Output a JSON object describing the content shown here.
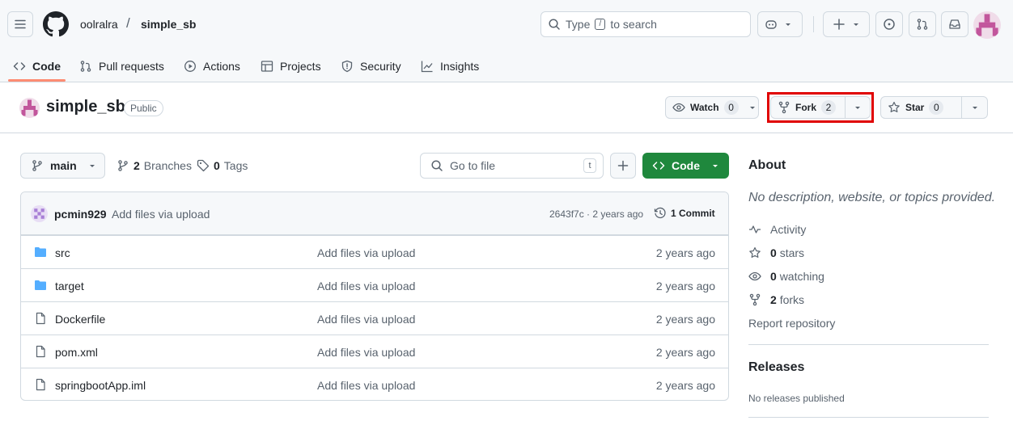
{
  "header": {
    "owner": "oolralra",
    "separator": "/",
    "repo": "simple_sb",
    "search": {
      "prefix": "Type",
      "key": "/",
      "suffix": "to search"
    }
  },
  "tabs": [
    {
      "label": "Code",
      "icon": "code-icon",
      "active": true
    },
    {
      "label": "Pull requests",
      "icon": "git-pull-request-icon"
    },
    {
      "label": "Actions",
      "icon": "play-icon"
    },
    {
      "label": "Projects",
      "icon": "table-icon"
    },
    {
      "label": "Security",
      "icon": "shield-icon"
    },
    {
      "label": "Insights",
      "icon": "graph-icon"
    }
  ],
  "repo": {
    "name": "simple_sb",
    "visibility": "Public",
    "watch": {
      "label": "Watch",
      "count": "0"
    },
    "fork": {
      "label": "Fork",
      "count": "2"
    },
    "star": {
      "label": "Star",
      "count": "0"
    }
  },
  "controls": {
    "branch": "main",
    "branches_count": "2",
    "branches_label": "Branches",
    "tags_count": "0",
    "tags_label": "Tags",
    "goto_placeholder": "Go to file",
    "goto_key": "t",
    "code_label": "Code"
  },
  "commit": {
    "user": "pcmin929",
    "message": "Add files via upload",
    "meta": "2643f7c · 2 years ago",
    "count_label": "1 Commit"
  },
  "files": [
    {
      "name": "src",
      "type": "folder",
      "message": "Add files via upload",
      "date": "2 years ago"
    },
    {
      "name": "target",
      "type": "folder",
      "message": "Add files via upload",
      "date": "2 years ago"
    },
    {
      "name": "Dockerfile",
      "type": "file",
      "message": "Add files via upload",
      "date": "2 years ago"
    },
    {
      "name": "pom.xml",
      "type": "file",
      "message": "Add files via upload",
      "date": "2 years ago"
    },
    {
      "name": "springbootApp.iml",
      "type": "file",
      "message": "Add files via upload",
      "date": "2 years ago"
    }
  ],
  "about": {
    "title": "About",
    "description": "No description, website, or topics provided.",
    "activity": "Activity",
    "stars_count": "0",
    "stars_label": "stars",
    "watching_count": "0",
    "watching_label": "watching",
    "forks_count": "2",
    "forks_label": "forks",
    "report": "Report repository"
  },
  "releases": {
    "title": "Releases",
    "empty": "No releases published"
  },
  "colors": {
    "accent_green": "#1f883d",
    "tab_underline": "#fd8c73",
    "highlight_red": "#e00000",
    "folder_blue": "#54aeff"
  }
}
